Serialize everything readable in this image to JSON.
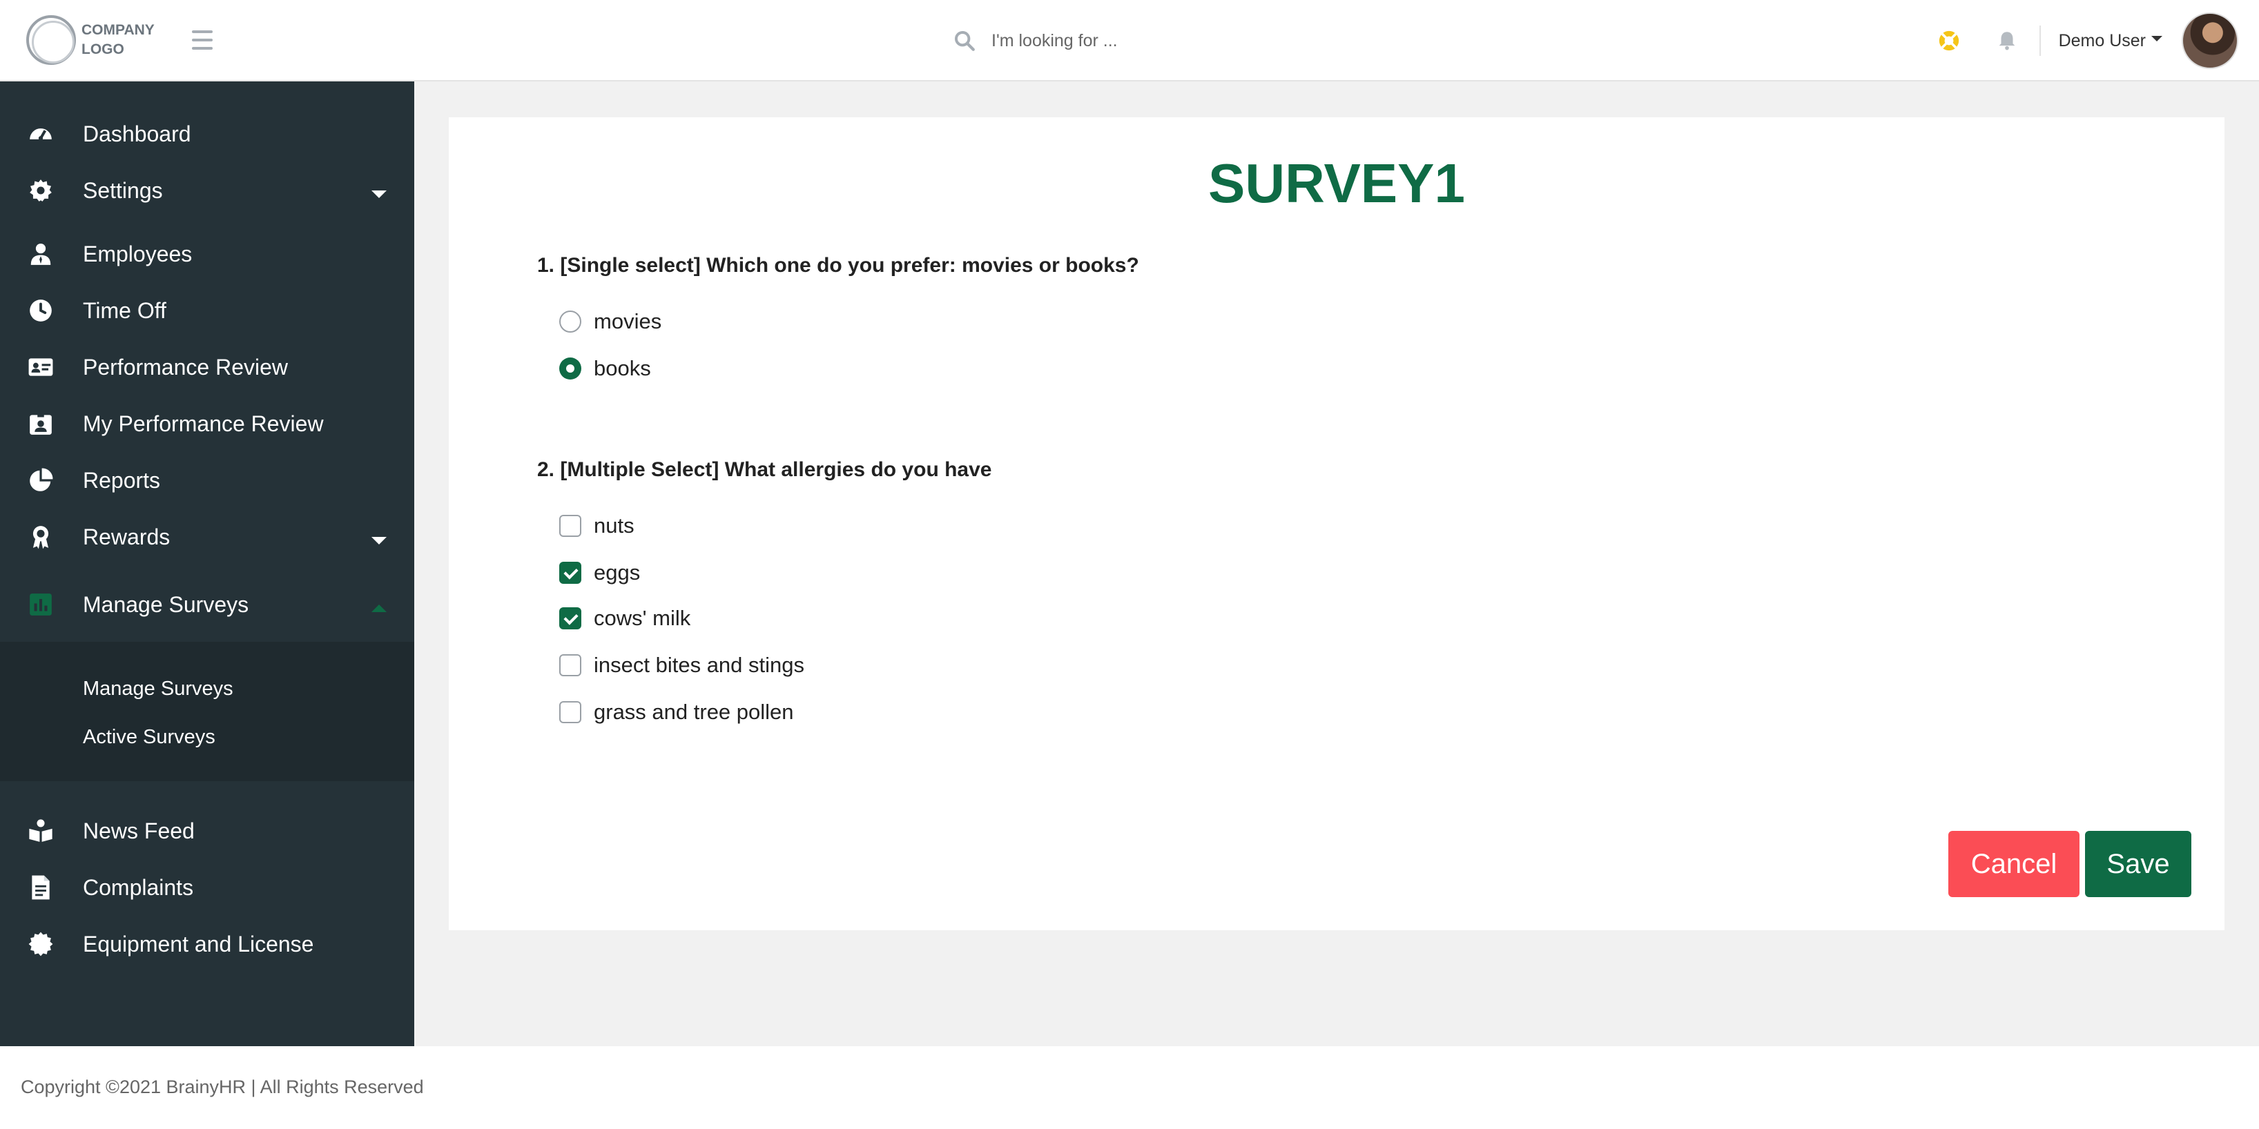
{
  "header": {
    "logo_line1": "COMPANY",
    "logo_line2": "LOGO",
    "search_placeholder": "I'm looking for ...",
    "user_name": "Demo User"
  },
  "sidebar": {
    "items": [
      {
        "label": "Dashboard",
        "icon": "dashboard-icon"
      },
      {
        "label": "Settings",
        "icon": "gear-icon"
      },
      {
        "label": "Employees",
        "icon": "user-icon"
      },
      {
        "label": "Time Off",
        "icon": "clock-icon"
      },
      {
        "label": "Performance Review",
        "icon": "id-card-icon"
      },
      {
        "label": "My Performance Review",
        "icon": "id-badge-icon"
      },
      {
        "label": "Reports",
        "icon": "pie-chart-icon"
      },
      {
        "label": "Rewards",
        "icon": "award-icon"
      },
      {
        "label": "Manage Surveys",
        "icon": "bar-chart-icon"
      },
      {
        "label": "News Feed",
        "icon": "reader-icon"
      },
      {
        "label": "Complaints",
        "icon": "file-icon"
      },
      {
        "label": "Equipment and License",
        "icon": "certificate-icon"
      }
    ],
    "submenu": [
      "Manage Surveys",
      "Active Surveys"
    ]
  },
  "survey": {
    "title": "SURVEY1",
    "questions": [
      {
        "text": "1. [Single select] Which one do you prefer: movies or books?",
        "options": [
          {
            "label": "movies",
            "checked": false
          },
          {
            "label": "books",
            "checked": true
          }
        ]
      },
      {
        "text": "2. [Multiple Select] What allergies do you have",
        "options": [
          {
            "label": "nuts",
            "checked": false
          },
          {
            "label": "eggs",
            "checked": true
          },
          {
            "label": "cows' milk",
            "checked": true
          },
          {
            "label": "insect bites and stings",
            "checked": false
          },
          {
            "label": "grass and tree pollen",
            "checked": false
          }
        ]
      }
    ],
    "cancel_label": "Cancel",
    "save_label": "Save"
  },
  "colors": {
    "brand_green": "#0f6b45",
    "cancel_red": "#fb4d55",
    "sidebar_bg": "#253238",
    "warning_yellow": "#f5c518"
  },
  "footer": {
    "copyright": "Copyright ©2021 BrainyHR | All Rights Reserved"
  }
}
